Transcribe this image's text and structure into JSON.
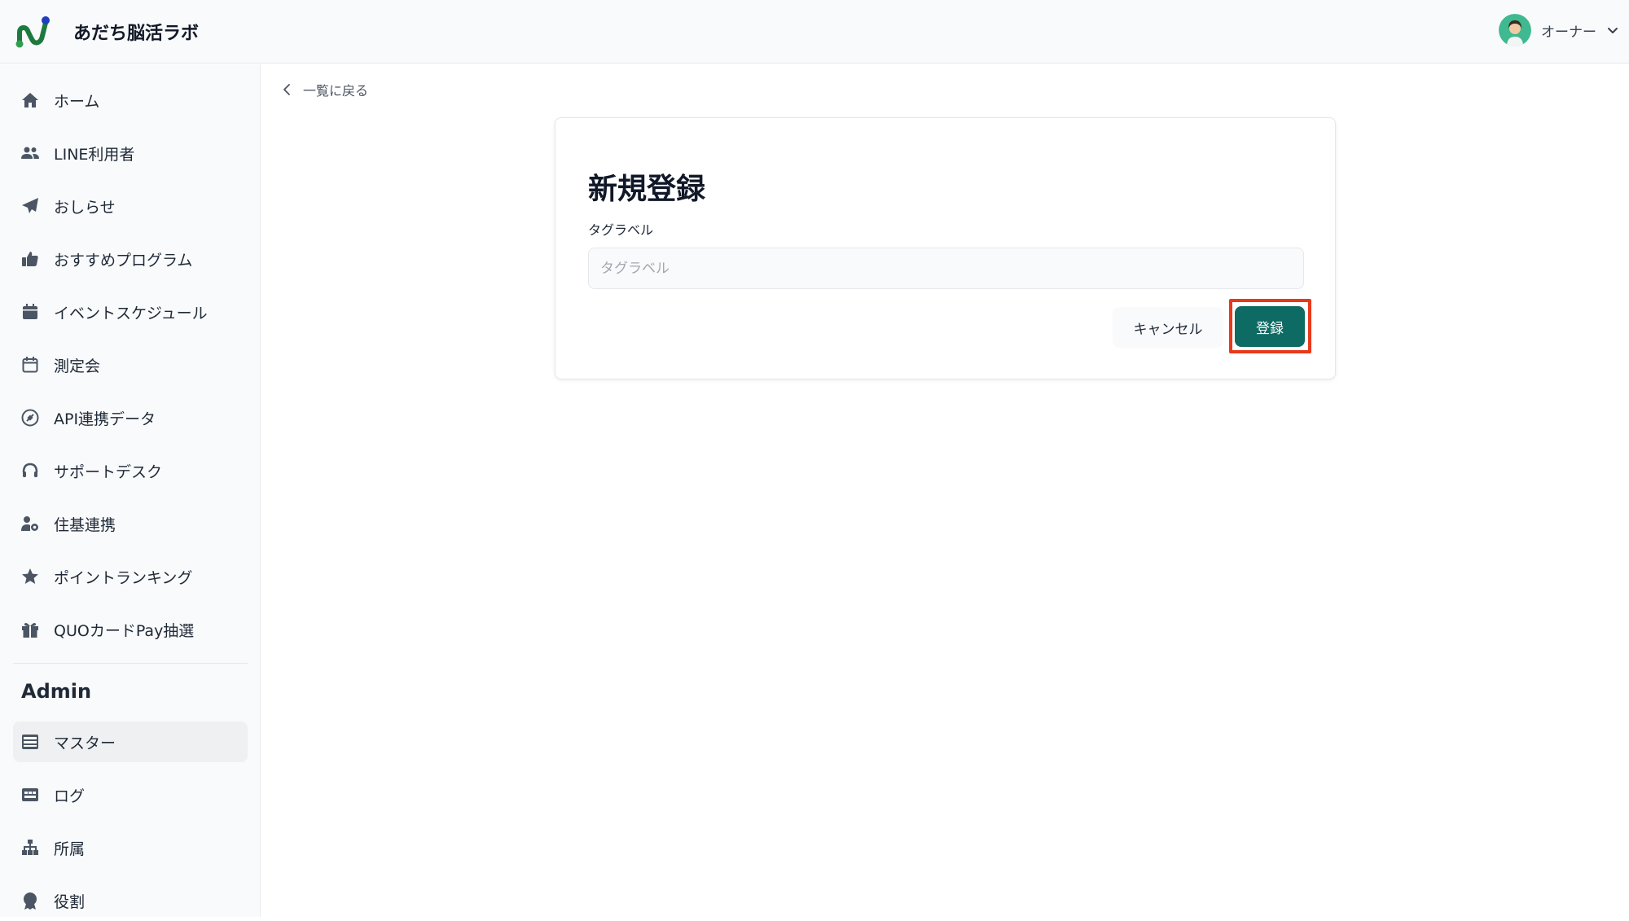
{
  "app": {
    "name": "あだち脳活ラボ",
    "accent_color": "#0d6b63",
    "logo_colors": [
      "#1d7a3e",
      "#2f9e4f",
      "#1f3fbf"
    ]
  },
  "user": {
    "role": "オーナー",
    "avatar_icon": "avatar-portrait",
    "menu_icon": "chevron-down-icon"
  },
  "sidebar": {
    "items": [
      {
        "label": "ホーム",
        "icon": "home-icon"
      },
      {
        "label": "LINE利用者",
        "icon": "users-icon"
      },
      {
        "label": "おしらせ",
        "icon": "paper-plane-icon"
      },
      {
        "label": "おすすめプログラム",
        "icon": "thumbs-up-icon"
      },
      {
        "label": "イベントスケジュール",
        "icon": "calendar-filled-icon"
      },
      {
        "label": "測定会",
        "icon": "calendar-outline-icon"
      },
      {
        "label": "API連携データ",
        "icon": "plug-icon"
      },
      {
        "label": "サポートデスク",
        "icon": "headset-icon"
      },
      {
        "label": "住基連携",
        "icon": "user-gear-icon"
      },
      {
        "label": "ポイントランキング",
        "icon": "star-icon"
      },
      {
        "label": "QUOカードPay抽選",
        "icon": "gift-icon"
      }
    ],
    "admin_section": {
      "title": "Admin",
      "items": [
        {
          "label": "マスター",
          "icon": "server-icon",
          "active": true
        },
        {
          "label": "ログ",
          "icon": "log-icon",
          "active": false
        },
        {
          "label": "所属",
          "icon": "sitemap-icon",
          "active": false
        },
        {
          "label": "役割",
          "icon": "award-icon",
          "active": false
        }
      ]
    }
  },
  "back_link": {
    "label": "一覧に戻る"
  },
  "form": {
    "title": "新規登録",
    "field_label": "タグラベル",
    "field_value": "",
    "field_placeholder": "タグラベル",
    "cancel_label": "キャンセル",
    "submit_label": "登録",
    "highlight_color": "#e8391b"
  }
}
